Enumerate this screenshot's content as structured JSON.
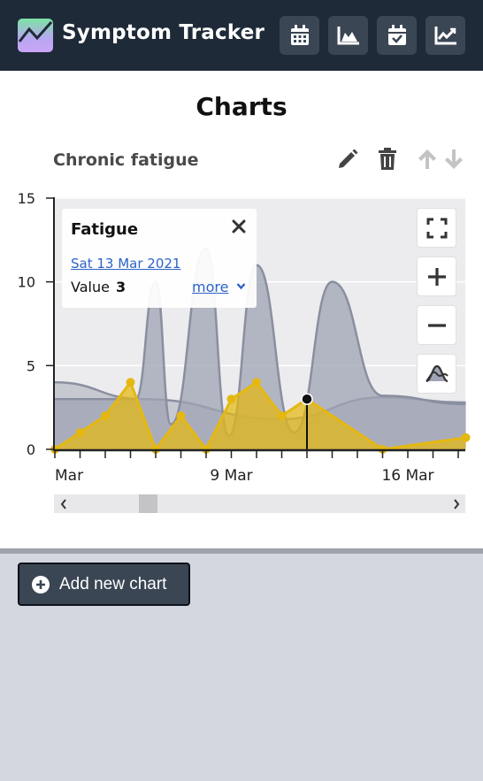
{
  "header": {
    "app_title": "Symptom Tracker",
    "logo_icon": "chart-logo-icon",
    "nav": [
      {
        "icon": "calendar-icon"
      },
      {
        "icon": "area-chart-icon"
      },
      {
        "icon": "calendar-check-icon"
      },
      {
        "icon": "line-chart-icon"
      }
    ]
  },
  "page": {
    "title": "Charts"
  },
  "chart_card": {
    "name": "Chronic fatigue",
    "tools": [
      "edit-icon",
      "delete-icon",
      "move-up-icon",
      "move-down-icon"
    ]
  },
  "tooltip": {
    "title": "Fatigue",
    "date": "Sat 13 Mar 2021",
    "value_label": "Value",
    "value": "3",
    "more_label": "more"
  },
  "controls": [
    "fullscreen-icon",
    "zoom-in-icon",
    "zoom-out-icon",
    "smoothing-icon"
  ],
  "add_button": {
    "label": "Add new chart"
  },
  "colors": {
    "header_bg": "#1e2a38",
    "nav_button_bg": "#3b4654",
    "fatigue_series": "#e5b811",
    "background_series": "#9fa3b3",
    "page_bg": "#d4d6e0",
    "link": "#2d63c8"
  },
  "chart_data": {
    "type": "area",
    "y_ticks": [
      "0",
      "5",
      "10",
      "15"
    ],
    "x_ticks": [
      "Mar",
      "9 Mar",
      "16 Mar"
    ],
    "ylim": [
      0,
      15
    ],
    "grid": true,
    "series": [
      {
        "name": "Fatigue",
        "color": "#e5b811",
        "points": [
          {
            "day": 0,
            "value": 0
          },
          {
            "day": 1,
            "value": 1
          },
          {
            "day": 2,
            "value": 2
          },
          {
            "day": 3,
            "value": 4
          },
          {
            "day": 4,
            "value": 0
          },
          {
            "day": 5,
            "value": 2
          },
          {
            "day": 6,
            "value": 0
          },
          {
            "day": 7,
            "value": 3
          },
          {
            "day": 8,
            "value": 4
          },
          {
            "day": 9,
            "value": 2
          },
          {
            "day": 10,
            "value": 3
          },
          {
            "day": 13,
            "value": 0
          },
          {
            "day": 16.3,
            "value": 0.7
          }
        ]
      },
      {
        "color": "#a9adba",
        "points": [
          {
            "day": 0,
            "value": 4
          },
          {
            "day": 3.5,
            "value": 3
          },
          {
            "day": 9,
            "value": 1.8
          },
          {
            "day": 13,
            "value": 3.1
          },
          {
            "day": 16.3,
            "value": 2.8
          }
        ]
      },
      {
        "color": "#9fa3b3",
        "points": [
          {
            "day": 0,
            "value": 3
          },
          {
            "day": 3.2,
            "value": 3
          },
          {
            "day": 4,
            "value": 10
          },
          {
            "day": 4.6,
            "value": 1.5
          },
          {
            "day": 6,
            "value": 12
          },
          {
            "day": 6.9,
            "value": 0.8
          },
          {
            "day": 8,
            "value": 11
          },
          {
            "day": 9.5,
            "value": 1
          },
          {
            "day": 11,
            "value": 10
          },
          {
            "day": 13,
            "value": 3.2
          },
          {
            "day": 16.3,
            "value": 2.7
          }
        ]
      }
    ],
    "selected": {
      "day": 10,
      "value": 3
    }
  }
}
